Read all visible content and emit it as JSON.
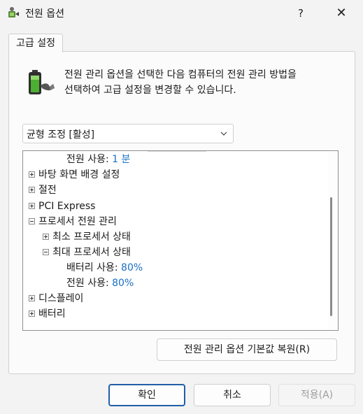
{
  "window": {
    "title": "전원 옵션",
    "help_label": "?",
    "close_label": "✕"
  },
  "tab": {
    "label": "고급 설정"
  },
  "description": {
    "line1": "전원 관리 옵션을 선택한 다음 컴퓨터의 전원 관리 방법을",
    "line2": "선택하여 고급 설정을 변경할 수 있습니다."
  },
  "plan_select": {
    "value": "균형 조정 [활성]"
  },
  "tree": {
    "items": [
      {
        "label": "전원 사용:",
        "value": "1 분"
      },
      {
        "label": "바탕 화면 배경 설정"
      },
      {
        "label": "절전"
      },
      {
        "label": "PCI Express"
      },
      {
        "label": "프로세서 전원 관리"
      },
      {
        "label": "최소 프로세서 상태"
      },
      {
        "label": "최대 프로세서 상태"
      },
      {
        "label": "배터리 사용:",
        "value": "80%"
      },
      {
        "label": "전원 사용:",
        "value": "80%"
      },
      {
        "label": "디스플레이"
      },
      {
        "label": "배터리"
      }
    ]
  },
  "restore_button": {
    "label": "전원 관리 옵션 기본값 복원(R)"
  },
  "footer": {
    "ok_label": "확인",
    "cancel_label": "취소",
    "apply_label": "적용(A)"
  },
  "colors": {
    "accent": "#1f5fa8",
    "value_blue": "#1a6fc4",
    "battery_green": "#4caf32"
  }
}
